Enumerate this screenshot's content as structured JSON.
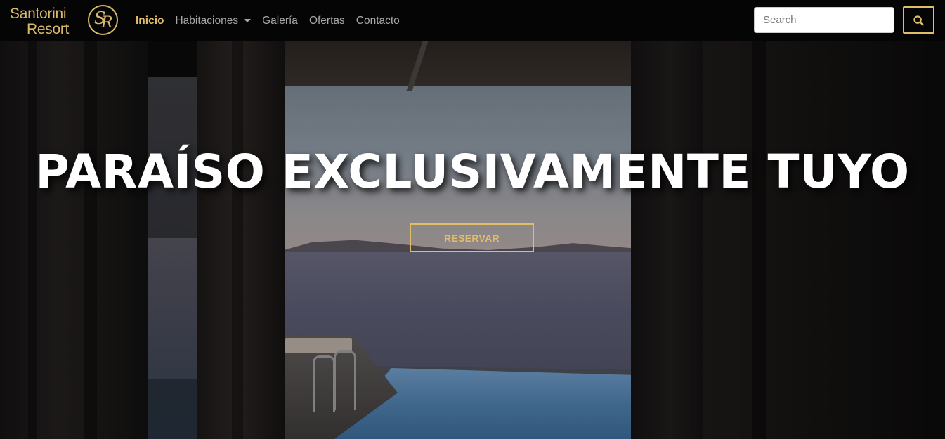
{
  "brand": {
    "line1": "Santorini",
    "line2": "Resort",
    "emblem_letters": [
      "S",
      "R"
    ],
    "color": "#d9b86a"
  },
  "nav": {
    "items": [
      {
        "label": "Inicio",
        "active": true
      },
      {
        "label": "Habitaciones",
        "dropdown": true
      },
      {
        "label": "Galería"
      },
      {
        "label": "Ofertas"
      },
      {
        "label": "Contacto"
      }
    ],
    "active_color": "#e2bd68",
    "link_color": "#a8a8a8"
  },
  "search": {
    "placeholder": "Search",
    "icon": "search-icon"
  },
  "hero": {
    "title": "PARAÍSO EXCLUSIVAMENTE TUYO",
    "cta_label": "RESERVAR",
    "accent_color": "#e2bd68"
  }
}
